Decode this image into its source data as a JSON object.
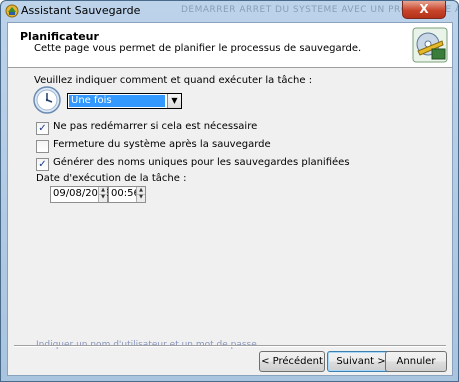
{
  "window": {
    "title": "Assistant Sauvegarde",
    "close_label": "X",
    "background_title": "DEMARRER ARRET DU SYSTEME AVEC UN PROGRAMME A.T.A. (Services)"
  },
  "header": {
    "title": "Planificateur",
    "subtitle": "Cette page vous permet de planifier le processus de sauvegarde."
  },
  "schedule": {
    "prompt": "Veuillez indiquer comment et quand exécuter la tâche :",
    "frequency": "Une fois",
    "frequency_arrow": "▼"
  },
  "options": [
    {
      "label": "Ne pas redémarrer si cela est nécessaire",
      "checked": true,
      "mark": "✓"
    },
    {
      "label": "Fermeture du système après la sauvegarde",
      "checked": false,
      "mark": ""
    },
    {
      "label": "Générer des noms uniques pour les sauvegardes planifiées",
      "checked": true,
      "mark": "✓"
    }
  ],
  "execution": {
    "label": "Date d'exécution de la tâche :",
    "date": "09/08/2013",
    "time": "00:56"
  },
  "footer": {
    "partial_link": "Indiquer un nom d'utilisateur et un mot de passe",
    "back_label": "< Précédent",
    "next_label": "Suivant >",
    "cancel_label": "Annuler"
  },
  "icons": {
    "app": "backup-app-icon",
    "clock": "clock-icon",
    "header": "backup-drive-icon"
  },
  "colors": {
    "selection": "#3399ff",
    "close": "#c8452c"
  }
}
